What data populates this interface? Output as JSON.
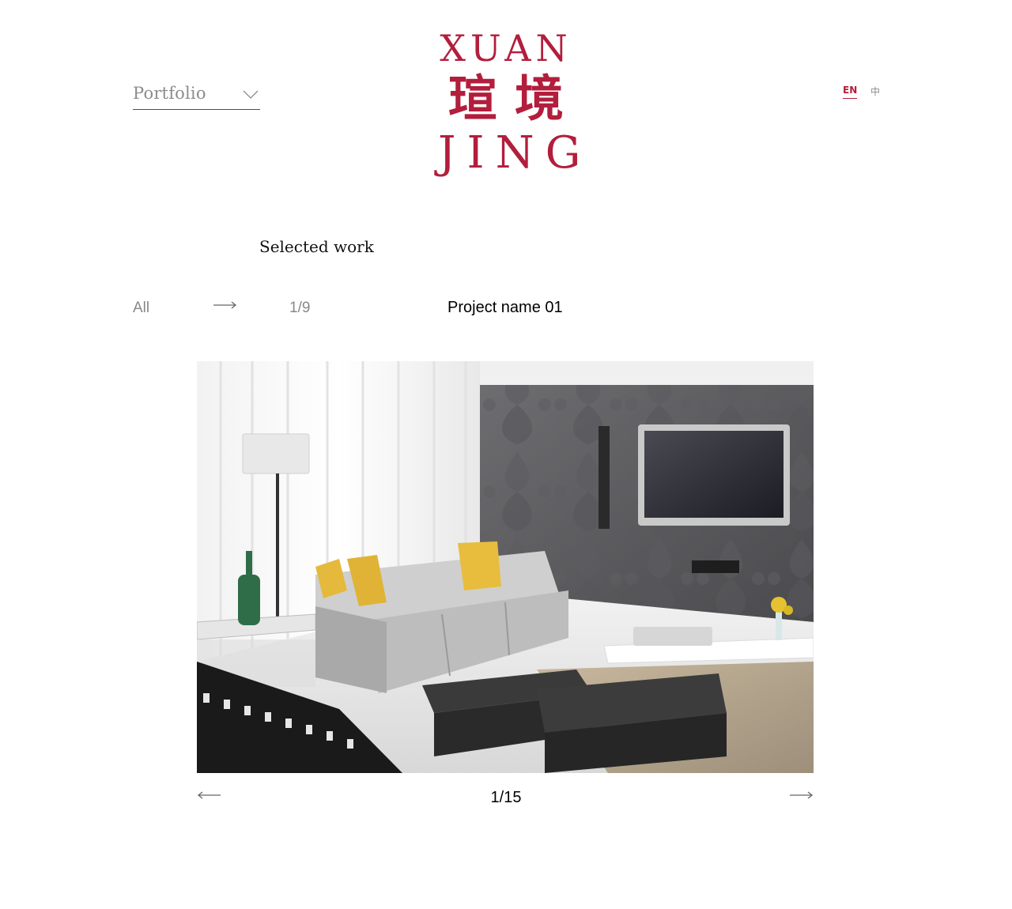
{
  "header": {
    "nav_label": "Portfolio",
    "logo": {
      "line_top": "XUAN",
      "line_mid": "瑄境",
      "line_bot": "JING"
    },
    "lang_en": "EN",
    "lang_zh": "中"
  },
  "section": {
    "title": "Selected work"
  },
  "filter": {
    "category": "All",
    "count": "1/9",
    "project_name": "Project name 01"
  },
  "gallery": {
    "slide_count": "1/15"
  },
  "colors": {
    "accent": "#b21e3c",
    "muted_text": "#888888"
  },
  "icons": {
    "dropdown": "chevron-down-icon",
    "next": "arrow-right-icon",
    "prev": "arrow-left-icon"
  }
}
